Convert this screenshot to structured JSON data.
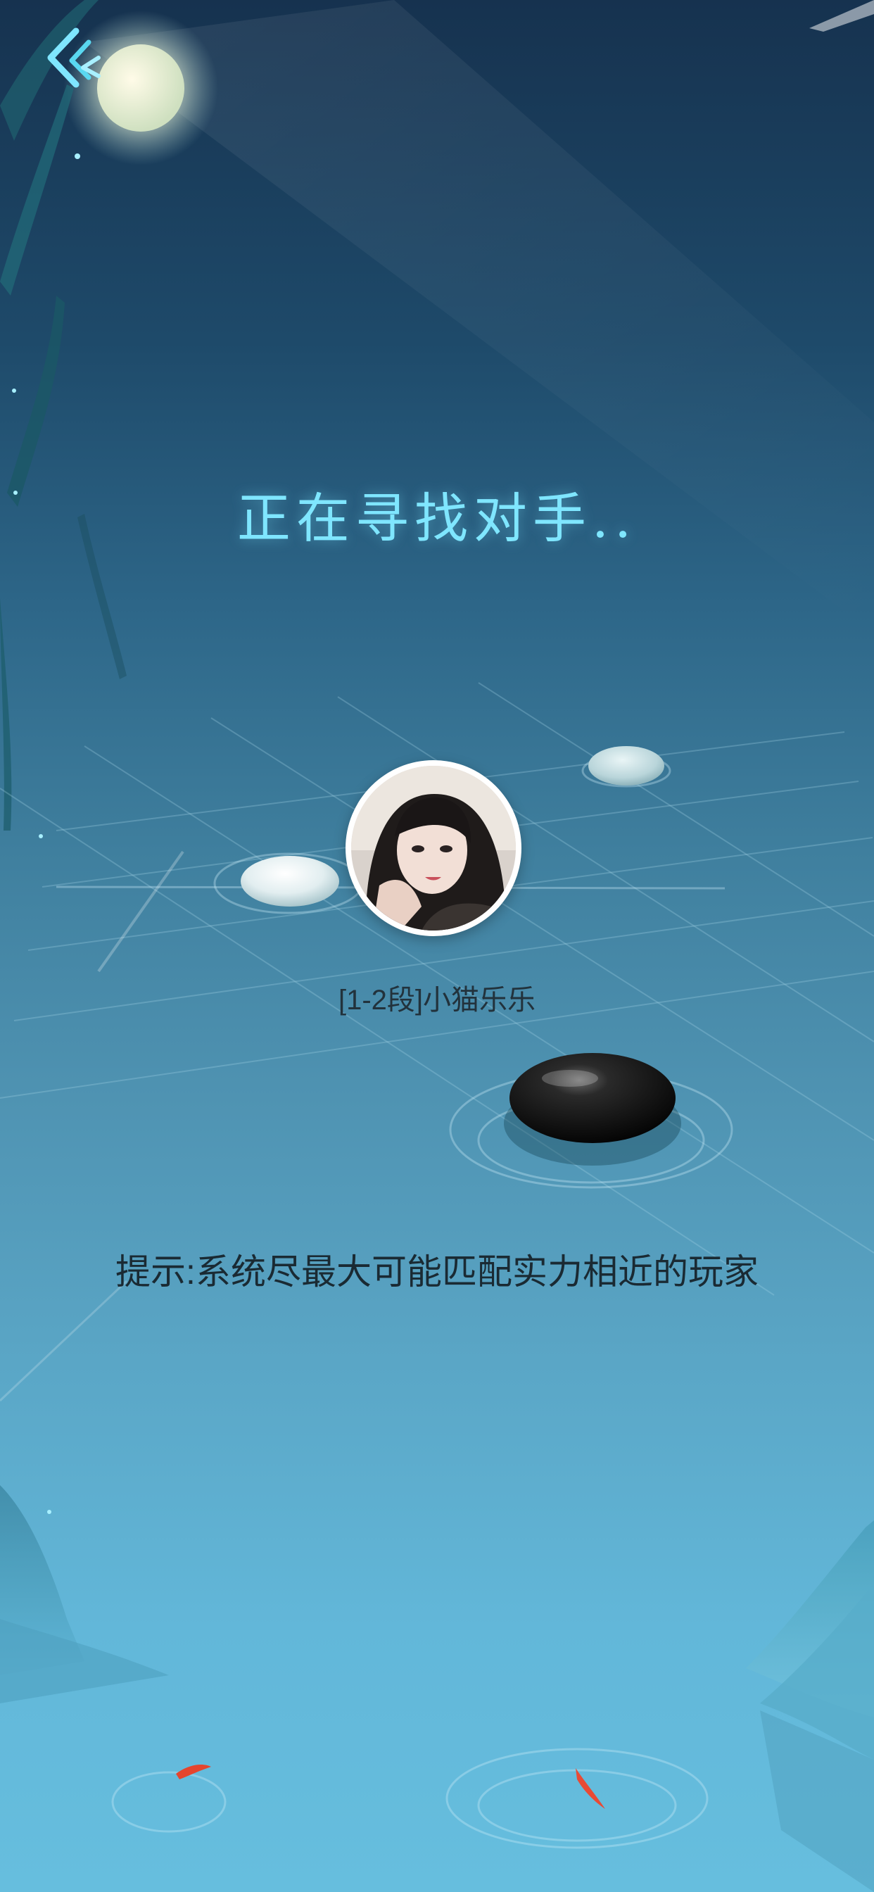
{
  "header": {
    "back_icon": "back-chevron-icon"
  },
  "matching": {
    "title": "正在寻找对手..",
    "player_name": "[1-2段]小猫乐乐",
    "tip": "提示:系统尽最大可能匹配实力相近的玩家"
  },
  "colors": {
    "title": "#7fe6ff",
    "accent": "#5ad8f0",
    "text_dark": "#1a2a33"
  }
}
